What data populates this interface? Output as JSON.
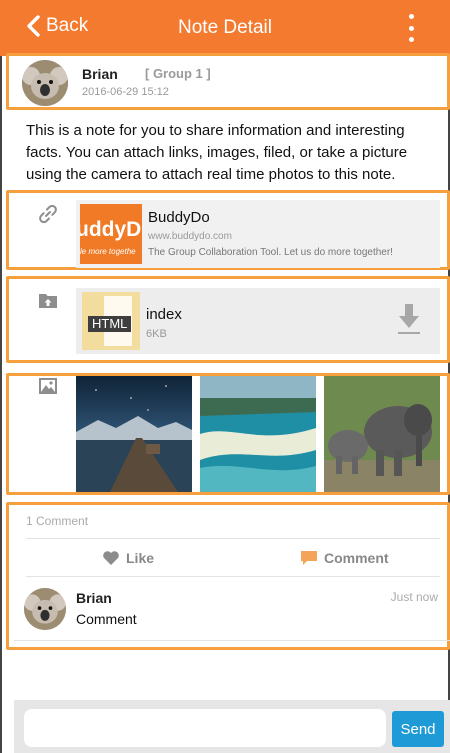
{
  "nav": {
    "back_label": "Back",
    "title": "Note Detail",
    "menu_icon": "more-vertical-icon"
  },
  "author": {
    "name": "Brian",
    "group": "[ Group 1 ]",
    "timestamp": "2016-06-29 15:12"
  },
  "note": {
    "text": "This is a note for you to share information and interesting facts. You can attach links, images, filed, or take a picture using the camera to attach real time photos to this note."
  },
  "link": {
    "icon": "link-icon",
    "logo_text": "uddyDo",
    "logo_tagline": "le more togethe",
    "title": "BuddyDo",
    "url": "www.buddydo.com",
    "description": "The Group Collaboration Tool. Let us do more together!"
  },
  "file": {
    "icon": "upload-folder-icon",
    "type_label": "HTML",
    "name": "index",
    "size": "6KB",
    "download_icon": "download-icon"
  },
  "photos": {
    "icon": "image-icon",
    "items": [
      {
        "subject": "pier-at-night"
      },
      {
        "subject": "beach-aerial"
      },
      {
        "subject": "elephants"
      }
    ]
  },
  "comments": {
    "count_label": "1 Comment",
    "like_label": "Like",
    "comment_label": "Comment",
    "items": [
      {
        "author": "Brian",
        "text": "Comment",
        "time": "Just now"
      }
    ]
  },
  "composer": {
    "placeholder": "",
    "send_label": "Send"
  },
  "colors": {
    "brand": "#f47a2f",
    "highlight": "#f5a03c",
    "send": "#1e9ad6"
  }
}
